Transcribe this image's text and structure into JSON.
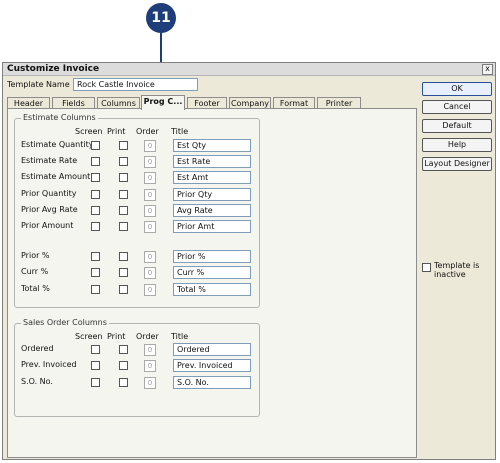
{
  "callout": {
    "number": "11"
  },
  "window": {
    "title": "Customize Invoice",
    "close_glyph": "x"
  },
  "template": {
    "label": "Template Name",
    "value": "Rock Castle Invoice"
  },
  "tabs": [
    "Header",
    "Fields",
    "Columns",
    "Prog C...",
    "Footer",
    "Company",
    "Format",
    "Printer"
  ],
  "estimate_columns": {
    "legend": "Estimate Columns",
    "headers": {
      "screen": "Screen",
      "print": "Print",
      "order": "Order",
      "title": "Title"
    },
    "rows": [
      {
        "label": "Estimate Quantity",
        "order": "0",
        "title": "Est Qty"
      },
      {
        "label": "Estimate Rate",
        "order": "0",
        "title": "Est Rate"
      },
      {
        "label": "Estimate Amount",
        "order": "0",
        "title": "Est Amt"
      },
      {
        "label": "Prior Quantity",
        "order": "0",
        "title": "Prior Qty"
      },
      {
        "label": "Prior Avg Rate",
        "order": "0",
        "title": "Avg Rate"
      },
      {
        "label": "Prior Amount",
        "order": "0",
        "title": "Prior Amt"
      },
      {
        "label": "Prior %",
        "order": "0",
        "title": "Prior %"
      },
      {
        "label": "Curr %",
        "order": "0",
        "title": "Curr %"
      },
      {
        "label": "Total %",
        "order": "0",
        "title": "Total %"
      }
    ]
  },
  "sales_order_columns": {
    "legend": "Sales Order Columns",
    "headers": {
      "screen": "Screen",
      "print": "Print",
      "order": "Order",
      "title": "Title"
    },
    "rows": [
      {
        "label": "Ordered",
        "order": "0",
        "title": "Ordered"
      },
      {
        "label": "Prev. Invoiced",
        "order": "0",
        "title": "Prev. Invoiced"
      },
      {
        "label": "S.O. No.",
        "order": "0",
        "title": "S.O. No."
      }
    ]
  },
  "buttons": {
    "ok": "OK",
    "cancel": "Cancel",
    "default": "Default",
    "help": "Help",
    "layout_designer": "Layout Designer"
  },
  "inactive": {
    "label": "Template is inactive"
  }
}
